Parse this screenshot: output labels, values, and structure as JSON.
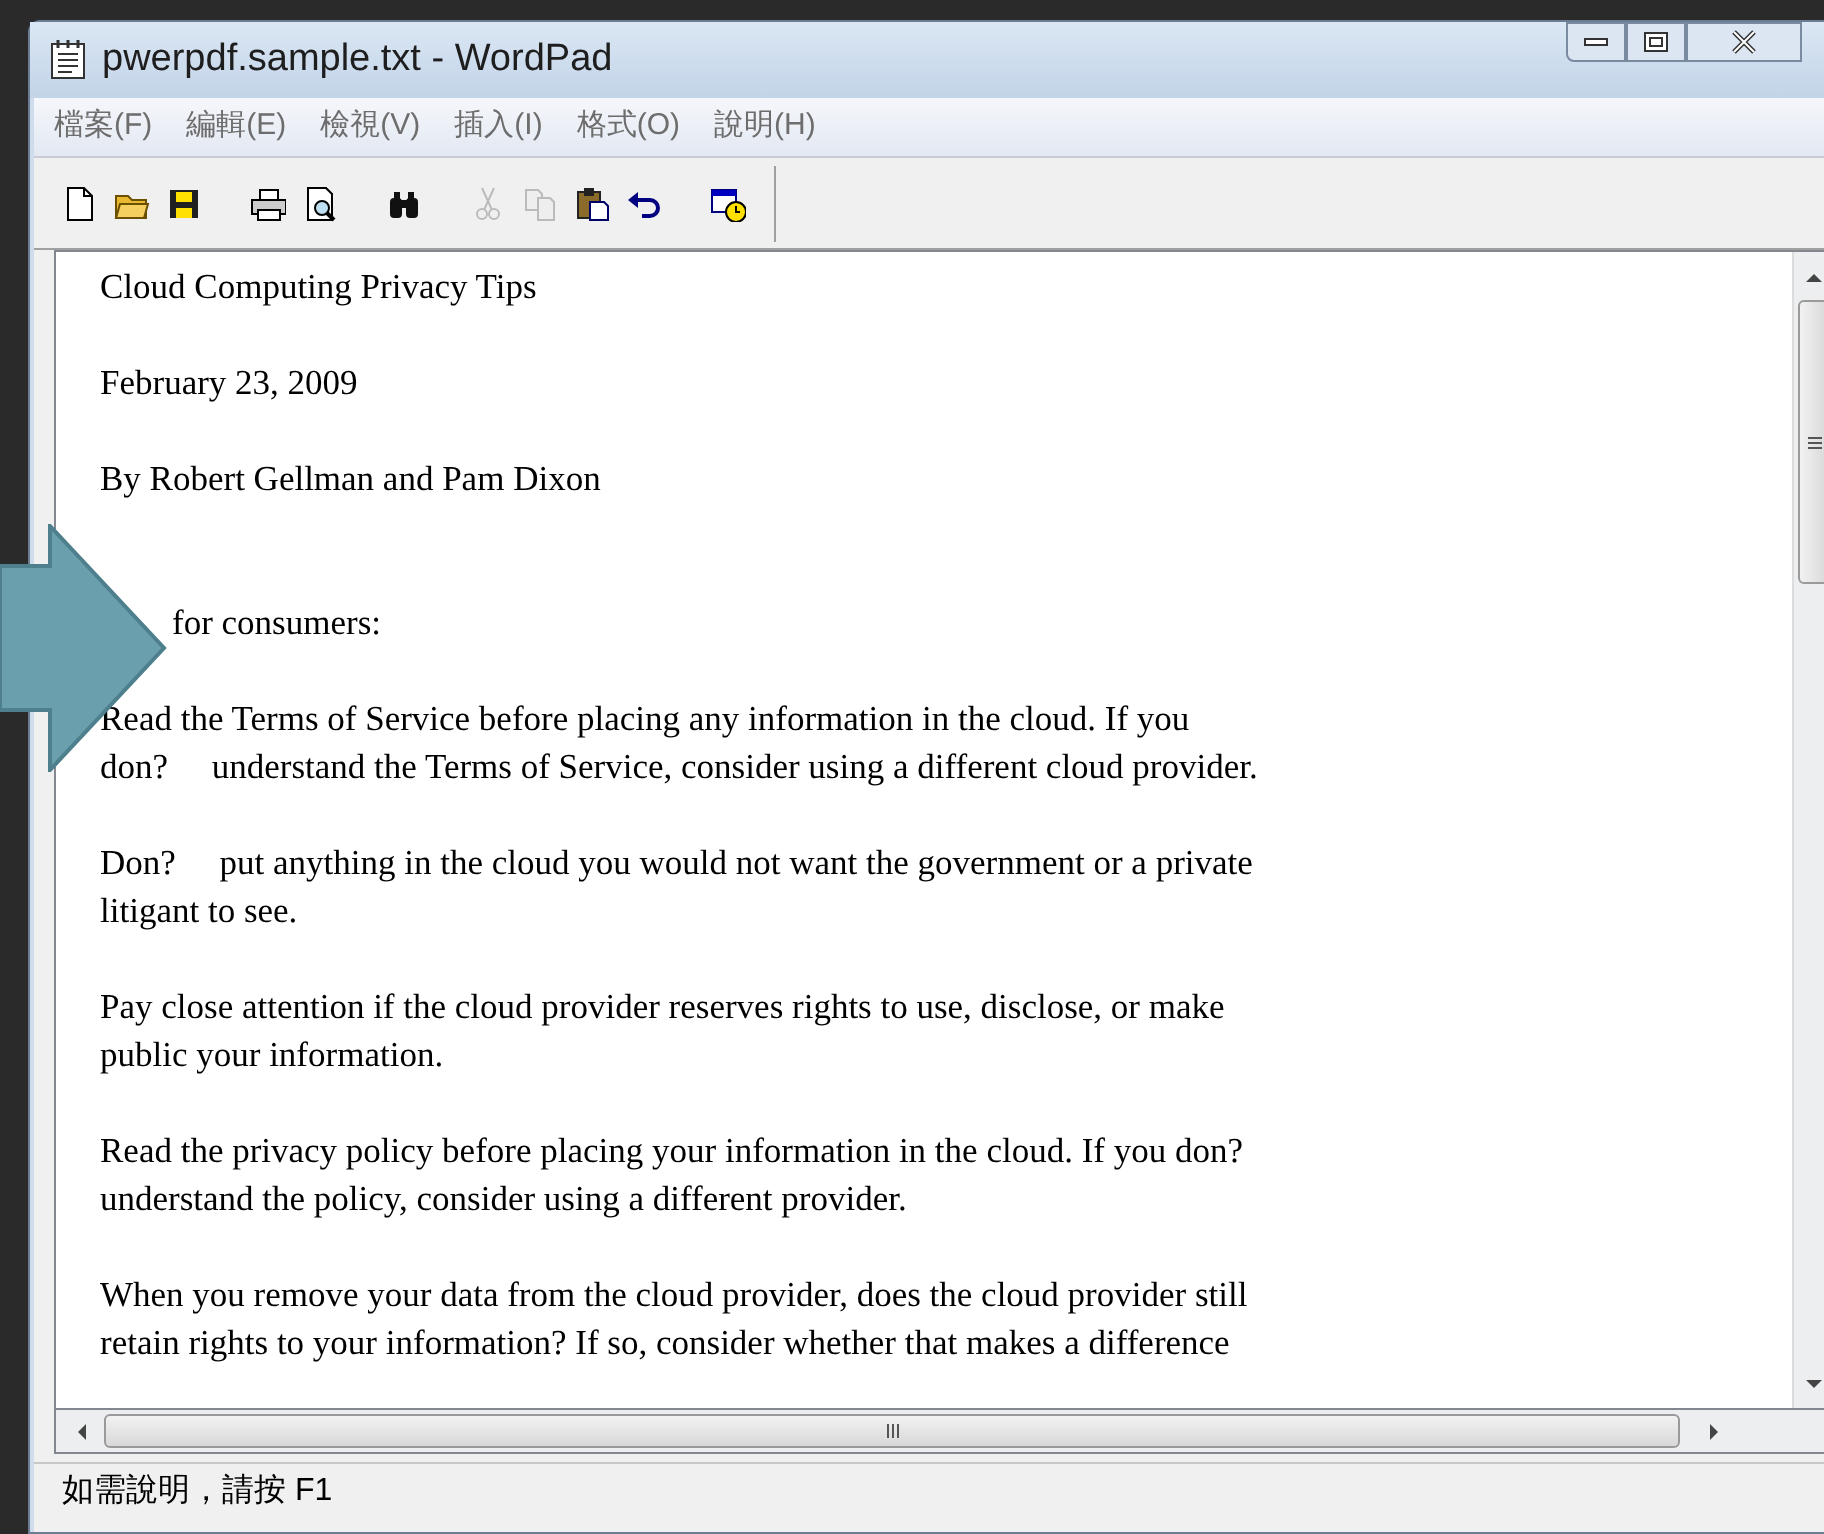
{
  "window": {
    "title": "pwerpdf.sample.txt - WordPad"
  },
  "menu": [
    "檔案(F)",
    "編輯(E)",
    "檢視(V)",
    "插入(I)",
    "格式(O)",
    "說明(H)"
  ],
  "toolbar": [
    {
      "kind": "new",
      "disabled": false
    },
    {
      "kind": "open",
      "disabled": false
    },
    {
      "kind": "save",
      "disabled": false
    },
    {
      "kind": "gap"
    },
    {
      "kind": "print",
      "disabled": false
    },
    {
      "kind": "preview",
      "disabled": false
    },
    {
      "kind": "gap"
    },
    {
      "kind": "find",
      "disabled": false
    },
    {
      "kind": "gap"
    },
    {
      "kind": "cut",
      "disabled": true
    },
    {
      "kind": "copy",
      "disabled": true
    },
    {
      "kind": "paste",
      "disabled": false
    },
    {
      "kind": "undo",
      "disabled": false
    },
    {
      "kind": "gap"
    },
    {
      "kind": "datetime",
      "disabled": false
    }
  ],
  "document": {
    "paragraphs": [
      [
        "Cloud Computing Privacy Tips"
      ],
      [
        "February 23, 2009"
      ],
      [
        "By Robert Gellman and Pam Dixon"
      ],
      [
        "for consumers:"
      ],
      [
        "Read the Terms of Service before placing any information in the cloud. If you",
        "don?     understand the Terms of Service, consider using a different cloud provider."
      ],
      [
        "Don?     put anything in the cloud you would not want the government or a private",
        "litigant to see."
      ],
      [
        "Pay close attention if the cloud provider reserves rights to use, disclose, or make",
        "public your information."
      ],
      [
        "Read the privacy policy before placing your information in the cloud. If you don?",
        "understand the policy, consider using a different provider."
      ],
      [
        "When you remove your data from the cloud provider, does the cloud provider still",
        "retain rights to your information? If so, consider whether that makes a difference"
      ]
    ]
  },
  "status_bar": {
    "text": "如需說明，請按 F1"
  }
}
